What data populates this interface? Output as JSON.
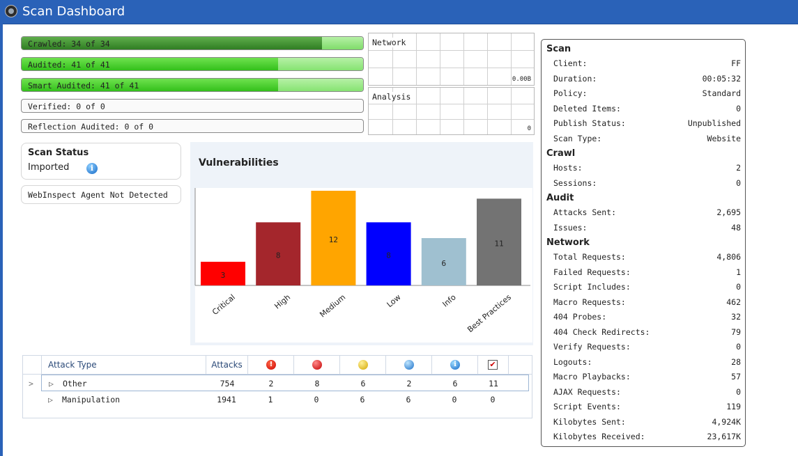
{
  "window": {
    "title": "Scan Dashboard"
  },
  "progress": [
    {
      "label": "Crawled: 34 of 34",
      "done": 34,
      "total": 34,
      "color": "green-dark"
    },
    {
      "label": "Audited: 41 of 41",
      "done": 41,
      "total": 41,
      "color": "green"
    },
    {
      "label": "Smart Audited: 41 of 41",
      "done": 41,
      "total": 41,
      "color": "green"
    },
    {
      "label": "Verified: 0 of 0",
      "done": 0,
      "total": 0,
      "color": "none"
    },
    {
      "label": "Reflection Audited: 0 of 0",
      "done": 0,
      "total": 0,
      "color": "none"
    }
  ],
  "network_graph": {
    "label": "Network",
    "value": "0.00B"
  },
  "analysis_graph": {
    "label": "Analysis",
    "value": "0"
  },
  "scan_status": {
    "heading": "Scan Status",
    "value": "Imported"
  },
  "agent": {
    "text": "WebInspect Agent  Not Detected"
  },
  "vulnerabilities": {
    "title": "Vulnerabilities"
  },
  "chart_data": {
    "type": "bar",
    "title": "Vulnerabilities",
    "categories": [
      "Critical",
      "High",
      "Medium",
      "Low",
      "Info",
      "Best Practices"
    ],
    "values": [
      3,
      8,
      12,
      8,
      6,
      11
    ],
    "colors": [
      "#ff0000",
      "#a4262c",
      "#ffa500",
      "#0000ff",
      "#9fc0d0",
      "#737373"
    ],
    "ylim": [
      0,
      12
    ],
    "grid": false
  },
  "attack_table": {
    "headers": {
      "attack_type": "Attack Type",
      "attacks": "Attacks"
    },
    "severity_icons": [
      "critical-icon",
      "high-icon",
      "medium-icon",
      "low-icon",
      "info-icon",
      "best-practice-icon"
    ],
    "rows": [
      {
        "name": "Other",
        "attacks": "754",
        "counts": [
          "2",
          "8",
          "6",
          "2",
          "6",
          "11"
        ],
        "selected": true
      },
      {
        "name": "Manipulation",
        "attacks": "1941",
        "counts": [
          "1",
          "0",
          "6",
          "6",
          "0",
          "0"
        ],
        "selected": false
      }
    ]
  },
  "summary": {
    "sections": [
      {
        "title": "Scan",
        "items": [
          {
            "label": "Client:",
            "value": "FF"
          },
          {
            "label": "Duration:",
            "value": "00:05:32"
          },
          {
            "label": "Policy:",
            "value": "Standard"
          },
          {
            "label": "Deleted Items:",
            "value": "0"
          },
          {
            "label": "Publish Status:",
            "value": "Unpublished"
          },
          {
            "label": "Scan Type:",
            "value": "Website"
          }
        ]
      },
      {
        "title": "Crawl",
        "items": [
          {
            "label": "Hosts:",
            "value": "2"
          },
          {
            "label": "Sessions:",
            "value": "0"
          }
        ]
      },
      {
        "title": "Audit",
        "items": [
          {
            "label": "Attacks Sent:",
            "value": "2,695"
          },
          {
            "label": "Issues:",
            "value": "48"
          }
        ]
      },
      {
        "title": "Network",
        "items": [
          {
            "label": "Total Requests:",
            "value": "4,806"
          },
          {
            "label": "Failed Requests:",
            "value": "1"
          },
          {
            "label": "Script Includes:",
            "value": "0"
          },
          {
            "label": "Macro Requests:",
            "value": "462"
          },
          {
            "label": "404 Probes:",
            "value": "32"
          },
          {
            "label": "404 Check Redirects:",
            "value": "79"
          },
          {
            "label": "Verify Requests:",
            "value": "0"
          },
          {
            "label": "Logouts:",
            "value": "28"
          },
          {
            "label": "Macro Playbacks:",
            "value": "57"
          },
          {
            "label": "AJAX Requests:",
            "value": "0"
          },
          {
            "label": "Script Events:",
            "value": "119"
          },
          {
            "label": "Kilobytes Sent:",
            "value": "4,924K"
          },
          {
            "label": "Kilobytes Received:",
            "value": "23,617K"
          }
        ]
      }
    ]
  }
}
